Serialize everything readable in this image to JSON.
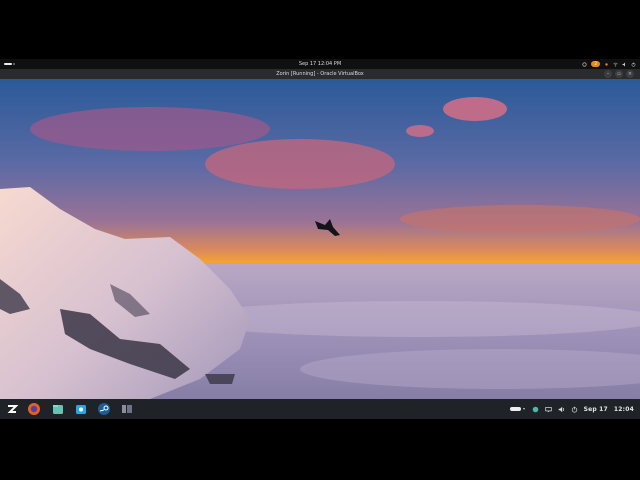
{
  "topbar": {
    "clock": "Sep 17  12:04 PM",
    "badge_count": "2"
  },
  "window": {
    "title": "Zorin [Running] - Oracle VirtualBox",
    "buttons": [
      "minimize-button",
      "maximize-button",
      "close-button"
    ]
  },
  "taskbar": {
    "apps": [
      {
        "name": "zorin-menu-icon"
      },
      {
        "name": "firefox-icon"
      },
      {
        "name": "files-icon"
      },
      {
        "name": "software-store-icon"
      },
      {
        "name": "steam-icon"
      },
      {
        "name": "window-switcher-icon"
      }
    ],
    "date": "Sep 17",
    "time": "12:04"
  },
  "colors": {
    "accent": "#e8891c",
    "panel": "#1f2226",
    "topbar": "#101010"
  }
}
